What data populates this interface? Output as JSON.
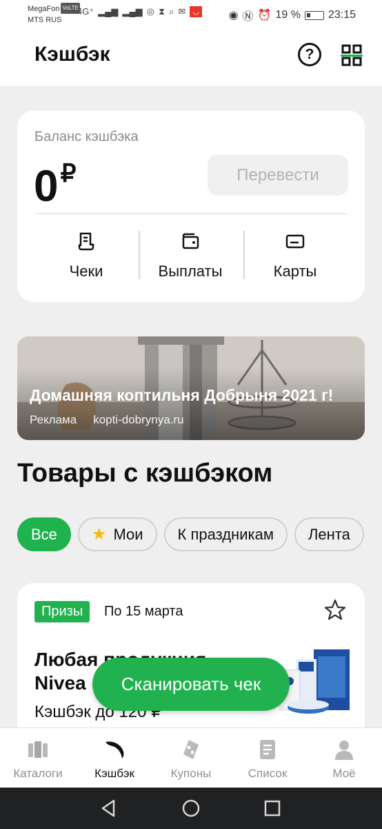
{
  "status_bar": {
    "carrier1": "MegaFon",
    "volte": "VoLTE",
    "carrier2": "MTS RUS",
    "network": "4G⁺",
    "battery": "19 %",
    "time": "23:15"
  },
  "header": {
    "title": "Кэшбэк",
    "help_icon": "?",
    "qr_icon_name": "qr-code-icon"
  },
  "balance": {
    "label": "Баланс кэшбэка",
    "value": "0",
    "currency": "₽",
    "transfer_label": "Перевести",
    "actions": [
      {
        "label": "Чеки",
        "icon": "receipt-icon"
      },
      {
        "label": "Выплаты",
        "icon": "wallet-icon"
      },
      {
        "label": "Карты",
        "icon": "card-icon"
      }
    ]
  },
  "ad": {
    "title": "Домашняя коптильня Добрыня 2021 г!",
    "tag": "Реклама",
    "domain": "kopti-dobrynya.ru"
  },
  "section": {
    "title": "Товары с кэшбэком",
    "chips": [
      {
        "label": "Все",
        "active": true
      },
      {
        "label": "Мои",
        "icon": "star-icon"
      },
      {
        "label": "К праздникам"
      },
      {
        "label": "Лента"
      }
    ]
  },
  "product": {
    "badge": "Призы",
    "deadline": "По 15 марта",
    "title": "Любая продукция Nivea",
    "cashback": "Кэшбэк до 120 ₽"
  },
  "scan_button": "Сканировать чек",
  "bottom_nav": [
    {
      "label": "Каталоги",
      "icon": "catalogs-icon"
    },
    {
      "label": "Кэшбэк",
      "icon": "cashback-icon",
      "active": true
    },
    {
      "label": "Купоны",
      "icon": "coupons-icon"
    },
    {
      "label": "Список",
      "icon": "list-icon"
    },
    {
      "label": "Моё",
      "icon": "profile-icon"
    }
  ],
  "colors": {
    "accent": "#21b24f",
    "background": "#efefef",
    "star": "#f6b80e"
  }
}
